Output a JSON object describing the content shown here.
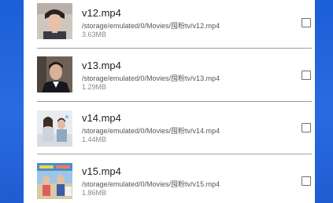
{
  "files": [
    {
      "name": "v12.mp4",
      "path": "/storage/emulated/0/Movies/囤粉tv/v12.mp4",
      "size": "3.63MB",
      "thumbnail": "man-portrait-thumbnail",
      "checked": false
    },
    {
      "name": "v13.mp4",
      "path": "/storage/emulated/0/Movies/囤粉tv/v13.mp4",
      "size": "1.29MB",
      "thumbnail": "man-suit-thumbnail",
      "checked": false
    },
    {
      "name": "v14.mp4",
      "path": "/storage/emulated/0/Movies/囤粉tv/v14.mp4",
      "size": "1.44MB",
      "thumbnail": "couple-scene-thumbnail",
      "checked": false
    },
    {
      "name": "v15.mp4",
      "path": "/storage/emulated/0/Movies/囤粉tv/v15.mp4",
      "size": "1.86MB",
      "thumbnail": "variety-show-thumbnail",
      "checked": false
    }
  ],
  "colors": {
    "background": "#2466dc",
    "panel": "#ffffff",
    "divider": "#9e9e9e",
    "title_text": "#222222",
    "path_text": "#555555",
    "size_text": "#8a8a8a"
  }
}
